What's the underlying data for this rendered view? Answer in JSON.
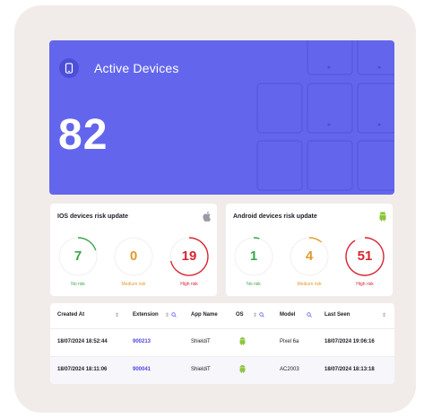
{
  "hero": {
    "title": "Active Devices",
    "count": "82",
    "icon": "phone-icon",
    "color": "#6366ec"
  },
  "ios_card": {
    "title": "IOS devices risk update",
    "icon": "apple-icon",
    "no_risk": {
      "value": "7",
      "label": "No risk"
    },
    "medium_risk": {
      "value": "0",
      "label": "Medium risk"
    },
    "high_risk": {
      "value": "19",
      "label": "High risk"
    }
  },
  "android_card": {
    "title": "Android devices risk update",
    "icon": "android-icon",
    "no_risk": {
      "value": "1",
      "label": "No risk"
    },
    "medium_risk": {
      "value": "4",
      "label": "Medium risk"
    },
    "high_risk": {
      "value": "51",
      "label": "High risk"
    }
  },
  "colors": {
    "green": "#3aa64c",
    "orange": "#e29b2b",
    "red": "#d62632",
    "accent": "#6366ec"
  },
  "table": {
    "headers": {
      "created_at": "Created At",
      "extension": "Extension",
      "app_name": "App Name",
      "os": "OS",
      "model": "Model",
      "last_seen": "Last Seen"
    },
    "rows": [
      {
        "created_at": "18/07/2024 18:52:44",
        "extension": "900213",
        "app_name": "ShieldiT",
        "os": "android-icon",
        "model": "Pixel 6a",
        "last_seen": "18/07/2024 19:06:16"
      },
      {
        "created_at": "18/07/2024 18:11:06",
        "extension": "900041",
        "app_name": "ShieldiT",
        "os": "android-icon",
        "model": "AC2003",
        "last_seen": "18/07/2024 18:13:18"
      }
    ]
  }
}
